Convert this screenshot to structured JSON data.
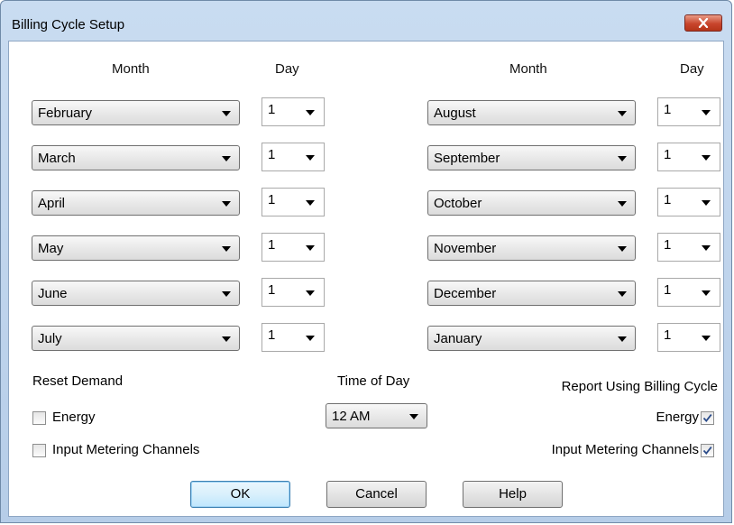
{
  "window": {
    "title": "Billing Cycle Setup"
  },
  "headers": {
    "month": "Month",
    "day": "Day"
  },
  "left_rows": [
    {
      "month": "February",
      "day": "1"
    },
    {
      "month": "March",
      "day": "1"
    },
    {
      "month": "April",
      "day": "1"
    },
    {
      "month": "May",
      "day": "1"
    },
    {
      "month": "June",
      "day": "1"
    },
    {
      "month": "July",
      "day": "1"
    }
  ],
  "right_rows": [
    {
      "month": "August",
      "day": "1"
    },
    {
      "month": "September",
      "day": "1"
    },
    {
      "month": "October",
      "day": "1"
    },
    {
      "month": "November",
      "day": "1"
    },
    {
      "month": "December",
      "day": "1"
    },
    {
      "month": "January",
      "day": "1"
    }
  ],
  "reset_demand": {
    "label": "Reset Demand",
    "energy": {
      "label": "Energy",
      "checked": false
    },
    "input_channels": {
      "label": "Input Metering Channels",
      "checked": false
    }
  },
  "time_of_day": {
    "label": "Time of Day",
    "value": "12 AM"
  },
  "report": {
    "label": "Report Using Billing Cycle",
    "energy": {
      "label": "Energy",
      "checked": true
    },
    "input_channels": {
      "label": "Input Metering Channels",
      "checked": true
    }
  },
  "buttons": {
    "ok": "OK",
    "cancel": "Cancel",
    "help": "Help"
  },
  "icons": {
    "close": "close-icon",
    "dropdown": "chevron-down-icon",
    "check": "check-icon"
  }
}
